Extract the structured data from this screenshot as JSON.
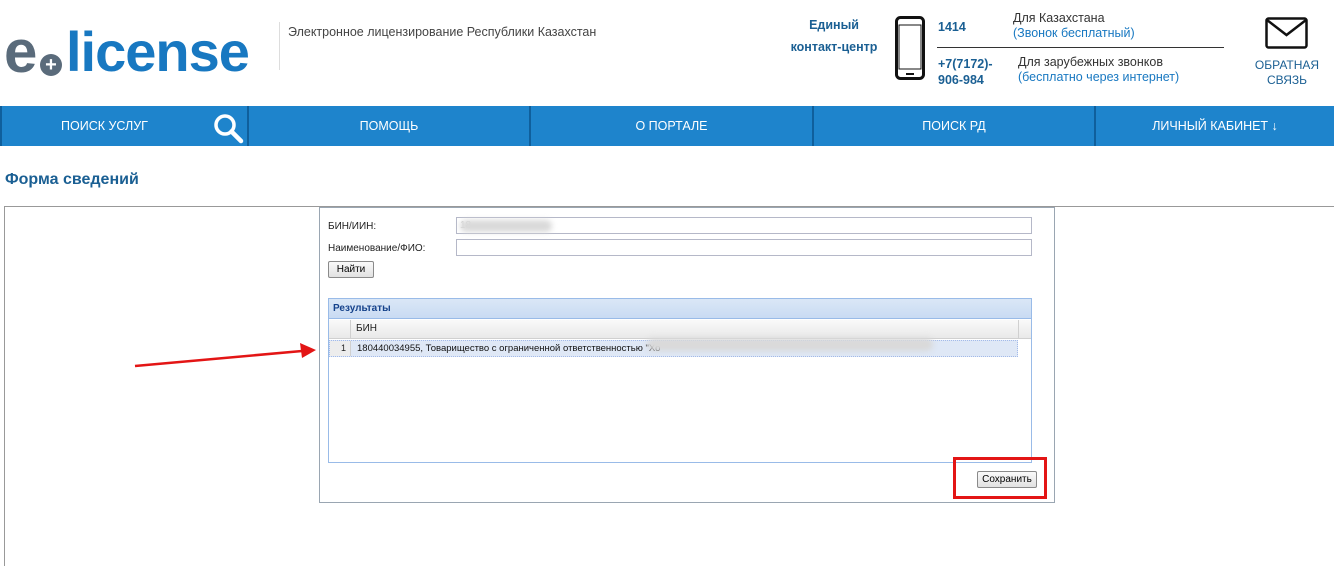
{
  "header": {
    "logo_e": "e",
    "logo_plus": "+",
    "logo_text": "license",
    "tagline": "Электронное лицензирование Республики Казахстан",
    "contact_title_1": "Единый",
    "contact_title_2": "контакт-центр",
    "phone_kz": "1414",
    "phone_kz_label": "Для Казахстана",
    "phone_kz_sub": "(Звонок бесплатный)",
    "phone_intl_1": "+7(7172)-",
    "phone_intl_2": "906-984",
    "phone_intl_label": "Для зарубежных звонков",
    "phone_intl_sub": "(бесплатно через интернет)",
    "feedback_1": "ОБРАТНАЯ",
    "feedback_2": "СВЯЗЬ"
  },
  "nav": {
    "items": [
      "ПОИСК УСЛУГ",
      "ПОМОЩЬ",
      "О ПОРТАЛЕ",
      "ПОИСК РД",
      "ЛИЧНЫЙ КАБИНЕТ ↓"
    ]
  },
  "form": {
    "title": "Форма сведений",
    "bin_label": "БИН/ИИН:",
    "bin_value": "18",
    "name_label": "Наименование/ФИО:",
    "name_value": "",
    "find_button": "Найти",
    "results_title": "Результаты",
    "col_bin": "БИН",
    "rows": [
      {
        "num": "1",
        "text": "180440034955, Товарищество с ограниченной ответственностью \"Хо"
      }
    ],
    "save_button": "Сохранить"
  },
  "colors": {
    "brand_blue": "#1878c1",
    "nav_bg": "#1e84cc",
    "annotation_red": "#e31515"
  }
}
